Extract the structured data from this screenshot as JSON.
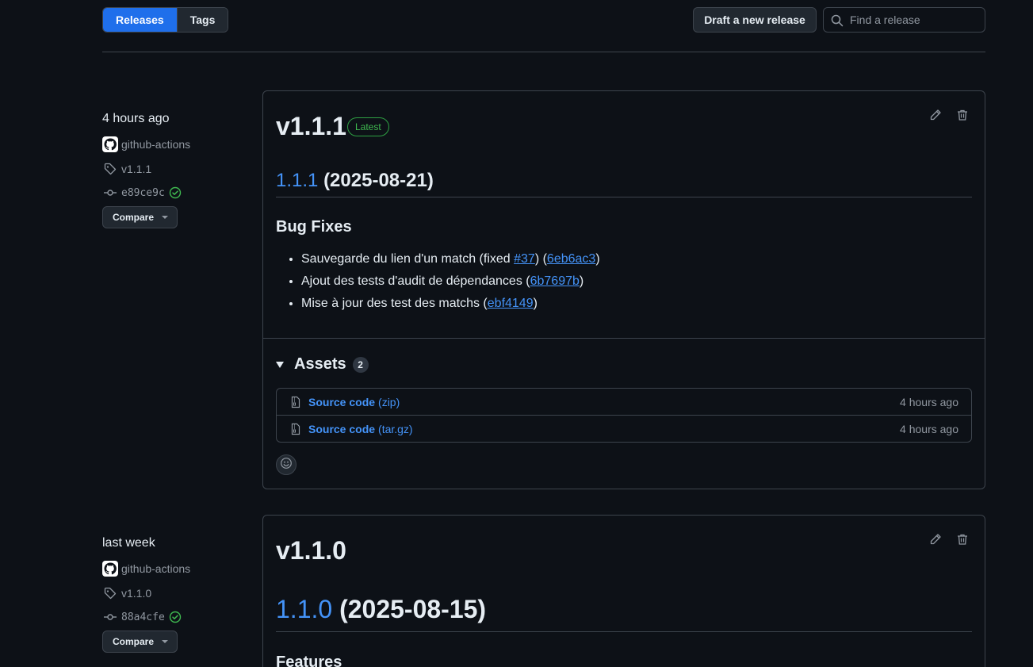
{
  "tabs": {
    "releases": "Releases",
    "tags": "Tags"
  },
  "actions": {
    "draft_label": "Draft a new release"
  },
  "search": {
    "placeholder": "Find a release",
    "value": ""
  },
  "releases": [
    {
      "time": "4 hours ago",
      "author": "github-actions",
      "tag": "v1.1.1",
      "commit": "e89ce9c",
      "compare_label": "Compare",
      "title": "v1.1.1",
      "badge": "Latest",
      "version_link": "1.1.1",
      "version_date": "(2025-08-21)",
      "section": "Bug Fixes",
      "notes": [
        {
          "text": "Sauvegarde du lien d'un match (fixed ",
          "issue": "#37",
          "mid": ") (",
          "commit": "6eb6ac3",
          "end": ")"
        },
        {
          "text": "Ajout des tests d'audit de dépendances (",
          "commit": "6b7697b",
          "end": ")"
        },
        {
          "text": "Mise à jour des test des matchs (",
          "commit": "ebf4149",
          "end": ")"
        }
      ],
      "assets_label": "Assets",
      "assets_count": "2",
      "assets": [
        {
          "name": "Source code",
          "ext": "(zip)",
          "time": "4 hours ago"
        },
        {
          "name": "Source code",
          "ext": "(tar.gz)",
          "time": "4 hours ago"
        }
      ]
    },
    {
      "time": "last week",
      "author": "github-actions",
      "tag": "v1.1.0",
      "commit": "88a4cfe",
      "compare_label": "Compare",
      "title": "v1.1.0",
      "version_link": "1.1.0",
      "version_date": "(2025-08-15)",
      "section": "Features"
    }
  ],
  "colors": {
    "background": "#0d1117",
    "accent": "#1f6feb",
    "link": "#4493f8",
    "success": "#3fb950",
    "border": "#3d444d"
  },
  "icons": [
    "search-icon",
    "github-logo-icon",
    "tag-icon",
    "commit-icon",
    "check-circle-icon",
    "pencil-icon",
    "trash-icon",
    "file-zip-icon",
    "smiley-icon"
  ]
}
